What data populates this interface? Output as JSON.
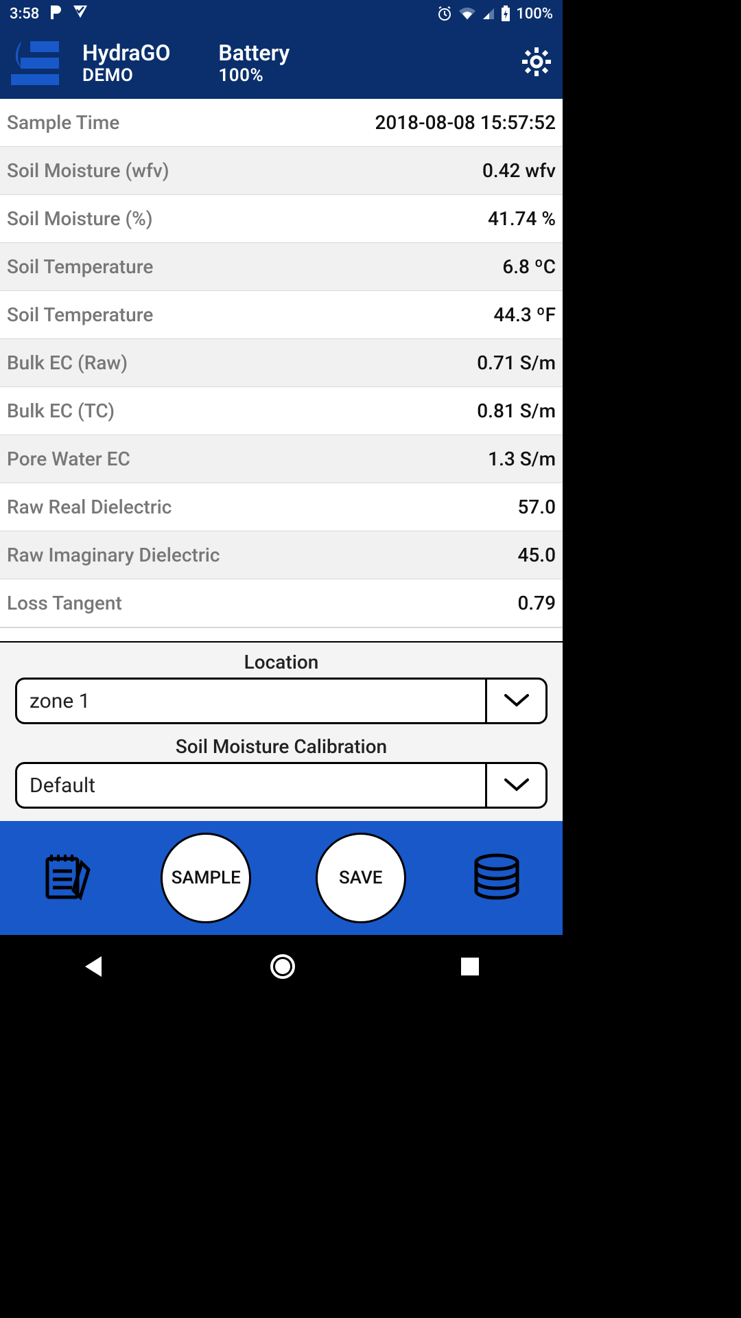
{
  "status": {
    "time": "3:58",
    "battery_text": "100%"
  },
  "header": {
    "app_name": "HydraGO",
    "app_sub": "DEMO",
    "battery_label": "Battery",
    "battery_value": "100%"
  },
  "rows": [
    {
      "label": "Sample Time",
      "value": "2018-08-08 15:57:52"
    },
    {
      "label": "Soil Moisture (wfv)",
      "value": "0.42 wfv"
    },
    {
      "label": "Soil Moisture (%)",
      "value": "41.74 %"
    },
    {
      "label": "Soil Temperature",
      "value": "6.8 ºC"
    },
    {
      "label": "Soil Temperature",
      "value": "44.3 ºF"
    },
    {
      "label": "Bulk EC (Raw)",
      "value": "0.71 S/m"
    },
    {
      "label": "Bulk EC (TC)",
      "value": "0.81 S/m"
    },
    {
      "label": "Pore Water EC",
      "value": "1.3 S/m"
    },
    {
      "label": "Raw Real Dielectric",
      "value": "57.0"
    },
    {
      "label": "Raw Imaginary Dielectric",
      "value": "45.0"
    },
    {
      "label": "Loss Tangent",
      "value": "0.79"
    }
  ],
  "selectors": {
    "location_label": "Location",
    "location_value": "zone 1",
    "calibration_label": "Soil Moisture Calibration",
    "calibration_value": "Default"
  },
  "actions": {
    "sample": "SAMPLE",
    "save": "SAVE"
  }
}
